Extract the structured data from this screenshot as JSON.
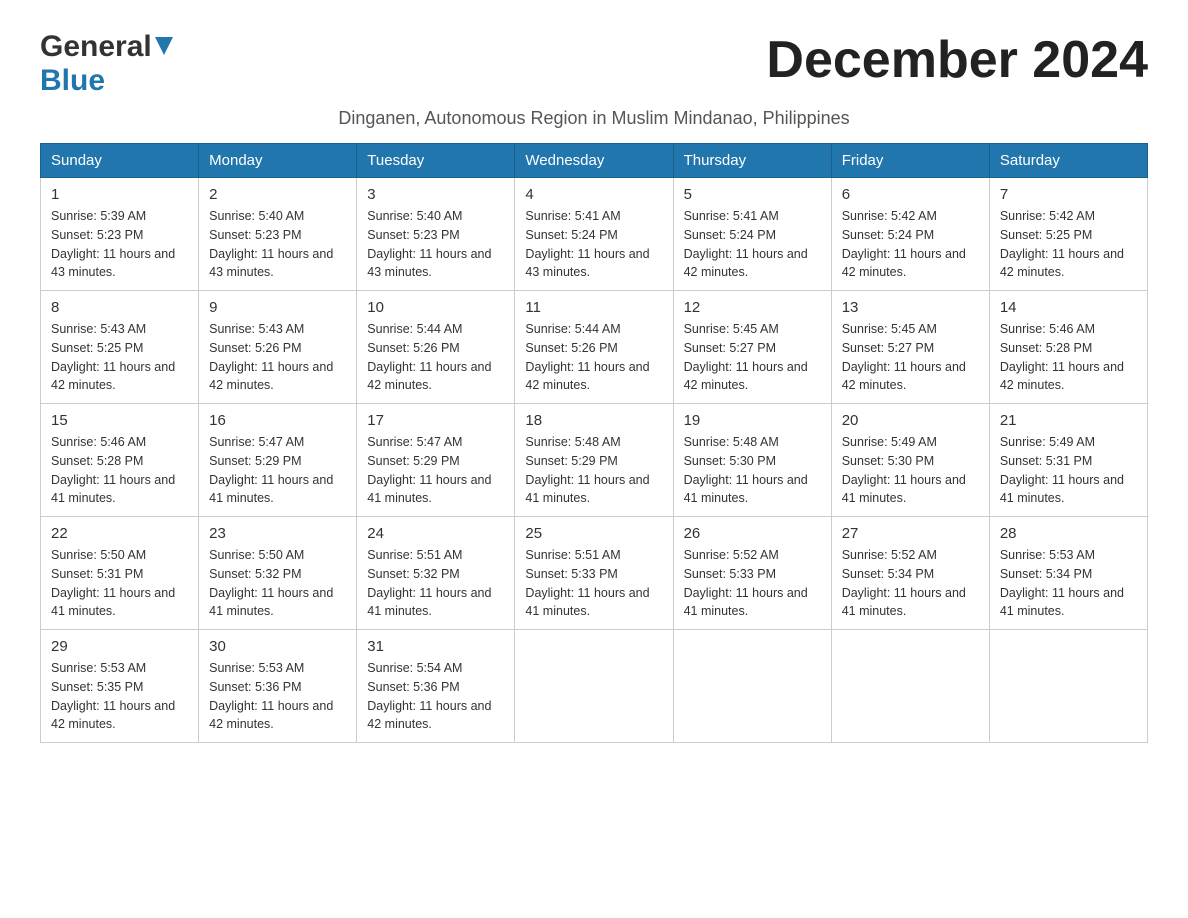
{
  "header": {
    "logo_line1": "General",
    "logo_line2": "Blue",
    "month_title": "December 2024",
    "subtitle": "Dinganen, Autonomous Region in Muslim Mindanao, Philippines"
  },
  "days_of_week": [
    "Sunday",
    "Monday",
    "Tuesday",
    "Wednesday",
    "Thursday",
    "Friday",
    "Saturday"
  ],
  "weeks": [
    [
      {
        "day": "1",
        "sunrise": "5:39 AM",
        "sunset": "5:23 PM",
        "daylight": "11 hours and 43 minutes."
      },
      {
        "day": "2",
        "sunrise": "5:40 AM",
        "sunset": "5:23 PM",
        "daylight": "11 hours and 43 minutes."
      },
      {
        "day": "3",
        "sunrise": "5:40 AM",
        "sunset": "5:23 PM",
        "daylight": "11 hours and 43 minutes."
      },
      {
        "day": "4",
        "sunrise": "5:41 AM",
        "sunset": "5:24 PM",
        "daylight": "11 hours and 43 minutes."
      },
      {
        "day": "5",
        "sunrise": "5:41 AM",
        "sunset": "5:24 PM",
        "daylight": "11 hours and 42 minutes."
      },
      {
        "day": "6",
        "sunrise": "5:42 AM",
        "sunset": "5:24 PM",
        "daylight": "11 hours and 42 minutes."
      },
      {
        "day": "7",
        "sunrise": "5:42 AM",
        "sunset": "5:25 PM",
        "daylight": "11 hours and 42 minutes."
      }
    ],
    [
      {
        "day": "8",
        "sunrise": "5:43 AM",
        "sunset": "5:25 PM",
        "daylight": "11 hours and 42 minutes."
      },
      {
        "day": "9",
        "sunrise": "5:43 AM",
        "sunset": "5:26 PM",
        "daylight": "11 hours and 42 minutes."
      },
      {
        "day": "10",
        "sunrise": "5:44 AM",
        "sunset": "5:26 PM",
        "daylight": "11 hours and 42 minutes."
      },
      {
        "day": "11",
        "sunrise": "5:44 AM",
        "sunset": "5:26 PM",
        "daylight": "11 hours and 42 minutes."
      },
      {
        "day": "12",
        "sunrise": "5:45 AM",
        "sunset": "5:27 PM",
        "daylight": "11 hours and 42 minutes."
      },
      {
        "day": "13",
        "sunrise": "5:45 AM",
        "sunset": "5:27 PM",
        "daylight": "11 hours and 42 minutes."
      },
      {
        "day": "14",
        "sunrise": "5:46 AM",
        "sunset": "5:28 PM",
        "daylight": "11 hours and 42 minutes."
      }
    ],
    [
      {
        "day": "15",
        "sunrise": "5:46 AM",
        "sunset": "5:28 PM",
        "daylight": "11 hours and 41 minutes."
      },
      {
        "day": "16",
        "sunrise": "5:47 AM",
        "sunset": "5:29 PM",
        "daylight": "11 hours and 41 minutes."
      },
      {
        "day": "17",
        "sunrise": "5:47 AM",
        "sunset": "5:29 PM",
        "daylight": "11 hours and 41 minutes."
      },
      {
        "day": "18",
        "sunrise": "5:48 AM",
        "sunset": "5:29 PM",
        "daylight": "11 hours and 41 minutes."
      },
      {
        "day": "19",
        "sunrise": "5:48 AM",
        "sunset": "5:30 PM",
        "daylight": "11 hours and 41 minutes."
      },
      {
        "day": "20",
        "sunrise": "5:49 AM",
        "sunset": "5:30 PM",
        "daylight": "11 hours and 41 minutes."
      },
      {
        "day": "21",
        "sunrise": "5:49 AM",
        "sunset": "5:31 PM",
        "daylight": "11 hours and 41 minutes."
      }
    ],
    [
      {
        "day": "22",
        "sunrise": "5:50 AM",
        "sunset": "5:31 PM",
        "daylight": "11 hours and 41 minutes."
      },
      {
        "day": "23",
        "sunrise": "5:50 AM",
        "sunset": "5:32 PM",
        "daylight": "11 hours and 41 minutes."
      },
      {
        "day": "24",
        "sunrise": "5:51 AM",
        "sunset": "5:32 PM",
        "daylight": "11 hours and 41 minutes."
      },
      {
        "day": "25",
        "sunrise": "5:51 AM",
        "sunset": "5:33 PM",
        "daylight": "11 hours and 41 minutes."
      },
      {
        "day": "26",
        "sunrise": "5:52 AM",
        "sunset": "5:33 PM",
        "daylight": "11 hours and 41 minutes."
      },
      {
        "day": "27",
        "sunrise": "5:52 AM",
        "sunset": "5:34 PM",
        "daylight": "11 hours and 41 minutes."
      },
      {
        "day": "28",
        "sunrise": "5:53 AM",
        "sunset": "5:34 PM",
        "daylight": "11 hours and 41 minutes."
      }
    ],
    [
      {
        "day": "29",
        "sunrise": "5:53 AM",
        "sunset": "5:35 PM",
        "daylight": "11 hours and 42 minutes."
      },
      {
        "day": "30",
        "sunrise": "5:53 AM",
        "sunset": "5:36 PM",
        "daylight": "11 hours and 42 minutes."
      },
      {
        "day": "31",
        "sunrise": "5:54 AM",
        "sunset": "5:36 PM",
        "daylight": "11 hours and 42 minutes."
      },
      null,
      null,
      null,
      null
    ]
  ]
}
